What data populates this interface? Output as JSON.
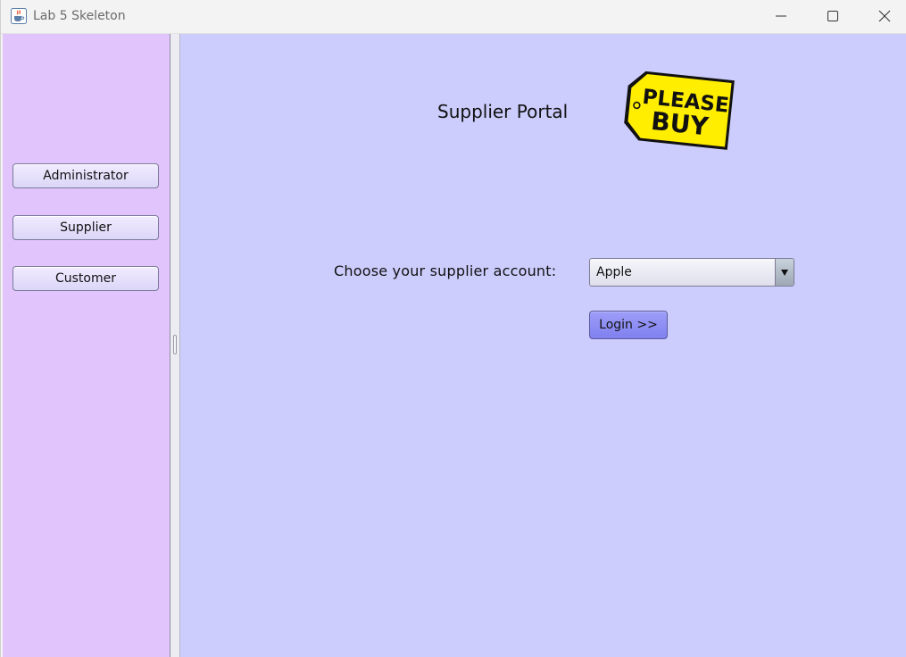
{
  "window": {
    "title": "Lab 5 Skeleton",
    "app_icon": "java-cup-icon",
    "controls": [
      "minimize-icon",
      "maximize-icon",
      "close-icon"
    ]
  },
  "left_panel": {
    "buttons": [
      {
        "label": "Administrator"
      },
      {
        "label": "Supplier"
      },
      {
        "label": "Customer"
      }
    ]
  },
  "main": {
    "title": "Supplier Portal",
    "logo": {
      "line1": "PLEASE",
      "line2": "BUY"
    },
    "supplier_label": "Choose your supplier account:",
    "supplier_select": {
      "selected": "Apple"
    },
    "login_button": "Login >>"
  },
  "colors": {
    "left_panel_bg": "#e0c4fb",
    "main_panel_bg": "#ccccfd",
    "login_button": "#8888f3",
    "logo_yellow": "#ffee00"
  }
}
